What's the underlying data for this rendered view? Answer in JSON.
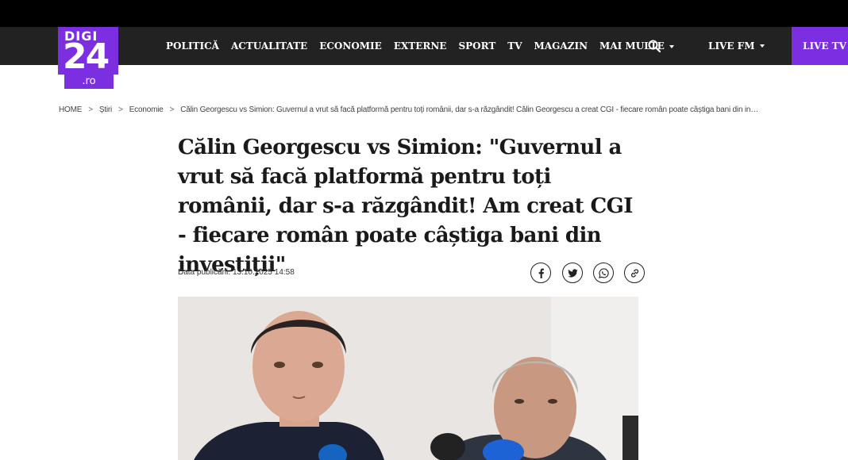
{
  "site": {
    "logo_top": "DIGI",
    "logo_num": "24",
    "logo_tld": ".ro",
    "brand_color": "#7b2fe0"
  },
  "nav": {
    "items": [
      "POLITICĂ",
      "ACTUALITATE",
      "ECONOMIE",
      "EXTERNE",
      "SPORT",
      "TV",
      "MAGAZIN"
    ],
    "more_label": "MAI MULTE",
    "search_icon": "search-icon",
    "live_fm_label": "LIVE FM",
    "live_tv_label": "LIVE TV"
  },
  "breadcrumb": {
    "items": [
      "HOME",
      "Știri",
      "Economie",
      "Călin Georgescu vs Simion: Guvernul a vrut să facă platformă pentru toți românii, dar s-a răzgândit! Călin Georgescu a creat CGI - fiecare român poate câștiga bani din in…"
    ],
    "separator": ">"
  },
  "article": {
    "title": "Călin Georgescu vs Simion: \"Guvernul a vrut să facă platformă pentru toți românii, dar s-a răzgândit! Am creat CGI - fiecare român poate câștiga bani din investiții\"",
    "date_label": "Data publicării:",
    "date_value": "13.10.2025 14:58"
  },
  "share": [
    "facebook-icon",
    "twitter-icon",
    "whatsapp-icon",
    "link-icon"
  ]
}
